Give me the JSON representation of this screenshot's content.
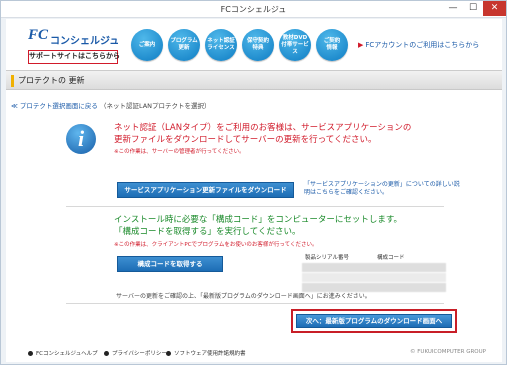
{
  "window": {
    "title": "FCコンシェルジュ",
    "minimize": "—",
    "maximize": "☐",
    "close": "✕"
  },
  "header": {
    "logo_fc": "FC",
    "logo_name": "コンシェルジュ",
    "support_label": "サポートサイトはこちらから",
    "nav": [
      {
        "label": "ご案内"
      },
      {
        "label": "プログラム\n更新"
      },
      {
        "label": "ネット認証\nライセンス"
      },
      {
        "label": "保守契約\n特典"
      },
      {
        "label": "教材DVD\n付帯サービス"
      },
      {
        "label": "ご契約\n情報"
      }
    ],
    "account_link": "FCアカウントのご利用はこちらから",
    "account_arrow": "▶"
  },
  "page": {
    "title": "プロテクトの 更新",
    "back_link": "≪ プロテクト選択画面に戻る",
    "back_note": "（ネット認証LANプロテクトを選択）"
  },
  "section1": {
    "line1": "ネット認証（LANタイプ）をご利用のお客様は、サービスアプリケーションの",
    "line2": "更新ファイルをダウンロードしてサーバーの更新を行ってください。",
    "note": "※この作業は、サーバーの管理者が行ってください。",
    "button": "サービスアプリケーション更新ファイルをダウンロード",
    "side_note": "「サービスアプリケーションの更新」についての詳しい説\n明はこちらをご確認ください。"
  },
  "section2": {
    "line1": "インストール時に必要な「構成コード」をコンピューターにセットします。",
    "line2": "「構成コードを取得する」を実行してください。",
    "note": "※この作業は、クライアントPCでプログラムをお使いのお客様が行ってください。",
    "button": "構成コードを取得する",
    "table_headers": [
      "製品シリアル番号",
      "構成コード"
    ]
  },
  "after_note": "サーバーの更新をご確認の上、「最新版プログラムのダウンロード画面へ」にお進みください。",
  "next_button": "次へ：最新版プログラムのダウンロード画面へ",
  "footer": {
    "links": [
      "FCコンシェルジュヘルプ",
      "プライバシーポリシー",
      "ソフトウェア使用許諾規約書"
    ],
    "copyright": "© FUKUICOMPUTER GROUP"
  },
  "colors": {
    "accent_blue": "#1d6db5",
    "alert_red": "#d11a2a",
    "green": "#1a8a2a",
    "highlight": "#c81e27"
  }
}
